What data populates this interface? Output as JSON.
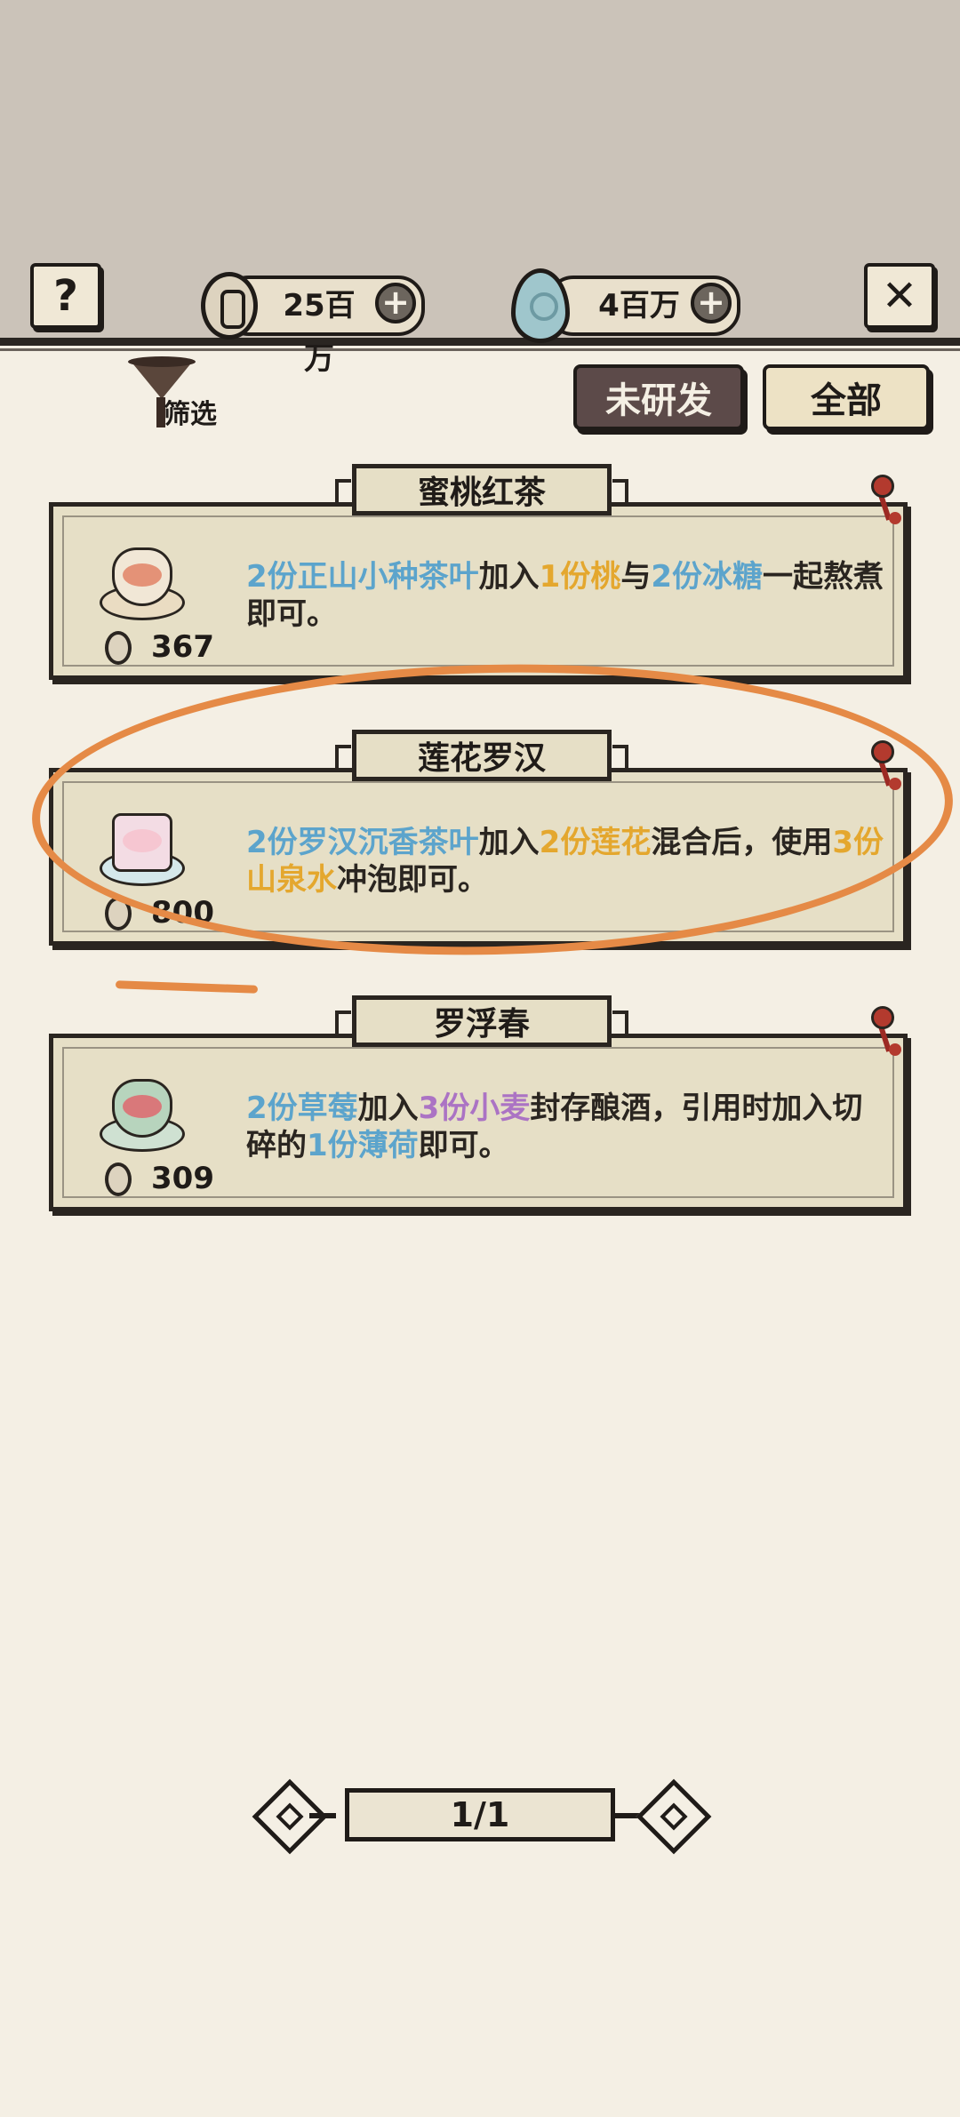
{
  "header": {
    "help_icon": "question-icon",
    "close_icon": "close-icon",
    "currency": [
      {
        "icon": "copper-coin-icon",
        "amount": "25百万",
        "plus": "+"
      },
      {
        "icon": "jade-icon",
        "amount": "4百万",
        "plus": "+"
      }
    ],
    "help_glyph": "?",
    "close_glyph": "✕"
  },
  "toolbar": {
    "filter_label": "筛选",
    "tabs": [
      "未研发",
      "全部"
    ]
  },
  "recipes": [
    {
      "name": "蜜桃红茶",
      "price": "367",
      "desc": [
        {
          "t": "2份正山小种茶叶",
          "c": "blue"
        },
        {
          "t": "加入",
          "c": "plain"
        },
        {
          "t": "1份桃",
          "c": "gold"
        },
        {
          "t": "与",
          "c": "plain"
        },
        {
          "t": "2份冰糖",
          "c": "blue"
        },
        {
          "t": "一起熬煮即可。",
          "c": "plain"
        }
      ]
    },
    {
      "name": "莲花罗汉",
      "price": "800",
      "desc": [
        {
          "t": "2份罗汉沉香茶叶",
          "c": "blue"
        },
        {
          "t": "加入",
          "c": "plain"
        },
        {
          "t": "2份莲花",
          "c": "gold"
        },
        {
          "t": "混合后，使用",
          "c": "plain"
        },
        {
          "t": "3份山泉水",
          "c": "gold"
        },
        {
          "t": "冲泡即可。",
          "c": "plain"
        }
      ]
    },
    {
      "name": "罗浮春",
      "price": "309",
      "desc": [
        {
          "t": "2份草莓",
          "c": "blue"
        },
        {
          "t": "加入",
          "c": "plain"
        },
        {
          "t": "3份小麦",
          "c": "purple"
        },
        {
          "t": "封存酿酒，引用时加入切碎的",
          "c": "plain"
        },
        {
          "t": "1份薄荷",
          "c": "blue"
        },
        {
          "t": "即可。",
          "c": "plain"
        }
      ]
    }
  ],
  "pager": {
    "label": "1/1"
  },
  "colors": {
    "blue": "#5ca4cc",
    "gold": "#e4a72e",
    "purple": "#ab73c4",
    "highlight": "#e58a46"
  }
}
